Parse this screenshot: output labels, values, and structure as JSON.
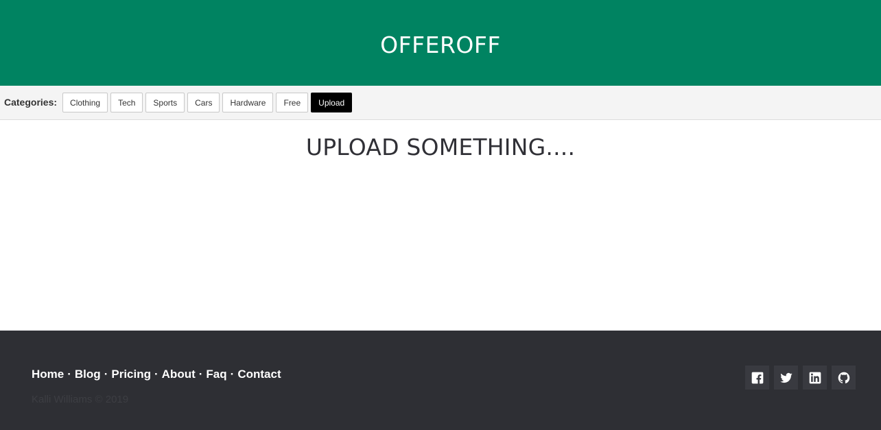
{
  "header": {
    "title": "OFFEROFF"
  },
  "categories": {
    "label": "Categories:",
    "items": [
      "Clothing",
      "Tech",
      "Sports",
      "Cars",
      "Hardware",
      "Free",
      "Upload"
    ],
    "active": "Upload"
  },
  "main": {
    "heading": "UPLOAD SOMETHING...."
  },
  "footer": {
    "links": [
      "Home",
      "Blog",
      "Pricing",
      "About",
      "Faq",
      "Contact"
    ],
    "separator": "·",
    "copyright": "Kalli Williams © 2019",
    "socials": [
      "facebook-icon",
      "twitter-icon",
      "linkedin-icon",
      "github-icon"
    ]
  },
  "colors": {
    "header_bg": "#008361",
    "footer_bg": "#2e2f34",
    "active_bg": "#000000"
  }
}
